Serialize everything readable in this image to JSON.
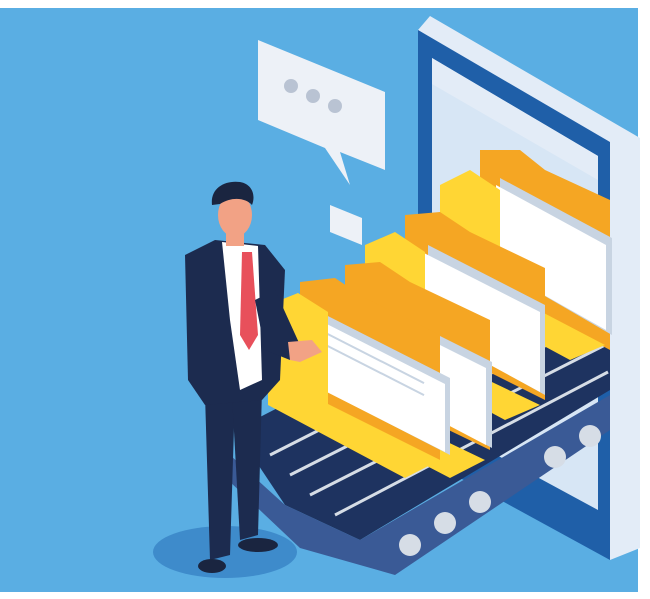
{
  "illustration": {
    "subject": "businessman-receiving-folders-from-phone-conveyor",
    "speech_bubble": {
      "dots": 3
    },
    "folders_count": 4,
    "colors": {
      "background": "#5AAEE3",
      "frame": "#FFFFFF",
      "phone_body": "#1F5FA8",
      "phone_screen": "#D7E6F5",
      "phone_bezel": "#E3ECF7",
      "folder_front": "#FFD634",
      "folder_back": "#F5A623",
      "folder_dark": "#E89A10",
      "paper": "#FFFFFF",
      "paper_shade": "#C8D4E2",
      "belt": "#1E3360",
      "belt_highlight": "#3A5A96",
      "roller": "#D6DDE6",
      "suit": "#1C2B4F",
      "shirt": "#FFFFFF",
      "tie": "#E8505B",
      "skin": "#F2A285",
      "hair": "#1A2540",
      "bubble": "#EDF1F7",
      "bubble_dots": "#B9C3D3",
      "floor_shadow": "#3E8BCB"
    }
  }
}
